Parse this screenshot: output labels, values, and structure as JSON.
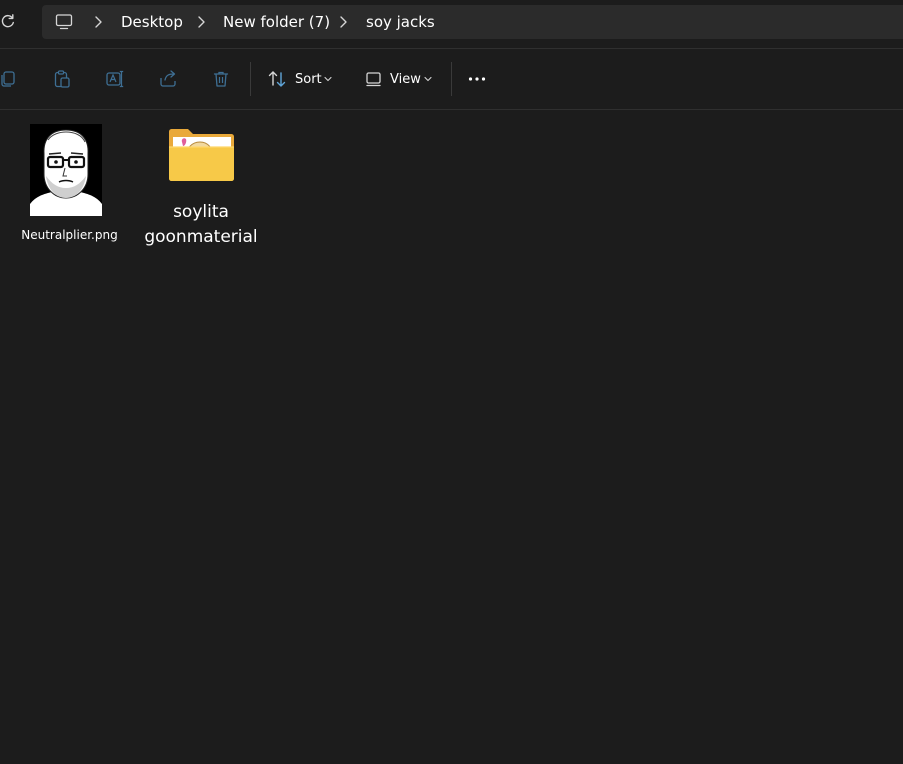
{
  "breadcrumb": {
    "items": [
      {
        "label": "Desktop"
      },
      {
        "label": "New folder (7)"
      },
      {
        "label": "soy jacks"
      }
    ]
  },
  "toolbar": {
    "sort_label": "Sort",
    "view_label": "View"
  },
  "files": [
    {
      "name": "Neutralplier.png",
      "icon": "image-thumbnail"
    },
    {
      "name_line1": "soylita",
      "name_line2": "goonmaterial",
      "icon": "folder-icon"
    }
  ],
  "colors": {
    "background": "#1c1c1c",
    "address_bg": "#2b2b2b",
    "folder_yellow": "#f7c948",
    "icon_blue": "#60a5d8"
  }
}
